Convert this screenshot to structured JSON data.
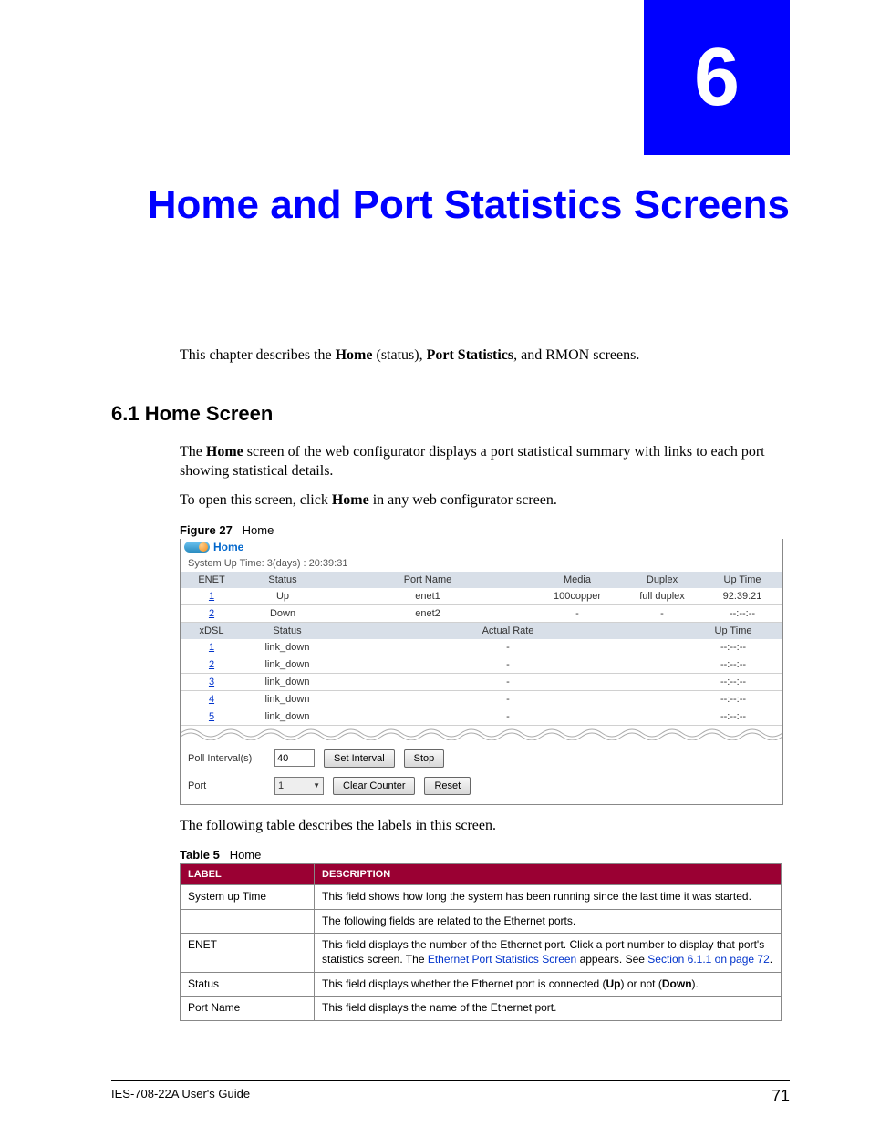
{
  "chapter": {
    "number": "6",
    "title": "Home and Port Statistics Screens"
  },
  "intro": {
    "pre": "This chapter describes the ",
    "b1": "Home",
    "mid1": " (status), ",
    "b2": "Port Statistics",
    "post": ", and RMON screens."
  },
  "section": {
    "heading": "6.1  Home Screen",
    "p1": {
      "pre": "The ",
      "b": "Home",
      "post": " screen of the web configurator displays a port statistical summary with links to each port showing statistical details."
    },
    "p2": {
      "pre": "To open this screen, click ",
      "b": "Home",
      "post": " in any web configurator screen."
    }
  },
  "figure": {
    "label": "Figure 27",
    "caption": "Home"
  },
  "screenshot": {
    "title": "Home",
    "uptime_label": "System Up Time: 3(days) : 20:39:31",
    "enet": {
      "headers": [
        "ENET",
        "Status",
        "Port Name",
        "Media",
        "Duplex",
        "Up Time"
      ],
      "rows": [
        {
          "port": "1",
          "status": "Up",
          "name": "enet1",
          "media": "100copper",
          "duplex": "full duplex",
          "uptime": "92:39:21"
        },
        {
          "port": "2",
          "status": "Down",
          "name": "enet2",
          "media": "-",
          "duplex": "-",
          "uptime": "--:--:--"
        }
      ]
    },
    "xdsl": {
      "headers": [
        "xDSL",
        "Status",
        "Actual Rate",
        "Up Time"
      ],
      "rows": [
        {
          "port": "1",
          "status": "link_down",
          "rate": "-",
          "uptime": "--:--:--"
        },
        {
          "port": "2",
          "status": "link_down",
          "rate": "-",
          "uptime": "--:--:--"
        },
        {
          "port": "3",
          "status": "link_down",
          "rate": "-",
          "uptime": "--:--:--"
        },
        {
          "port": "4",
          "status": "link_down",
          "rate": "-",
          "uptime": "--:--:--"
        },
        {
          "port": "5",
          "status": "link_down",
          "rate": "-",
          "uptime": "--:--:--"
        }
      ]
    },
    "controls": {
      "poll_label": "Poll Interval(s)",
      "poll_value": "40",
      "set_interval": "Set Interval",
      "stop": "Stop",
      "port_label": "Port",
      "port_value": "1",
      "clear_counter": "Clear Counter",
      "reset": "Reset"
    }
  },
  "after_fig": "The following table describes the labels in this screen.",
  "table": {
    "label": "Table 5",
    "caption": "Home",
    "headers": [
      "LABEL",
      "DESCRIPTION"
    ],
    "rows": [
      {
        "label": "System up Time",
        "desc": "This field shows how long the system has been running since the last time it was started."
      },
      {
        "label": "",
        "desc": "The following fields are related to the Ethernet ports."
      },
      {
        "label": "ENET",
        "desc_pre": "This field displays the number of the Ethernet port. Click a port number to display that port's statistics screen. The ",
        "link1": "Ethernet Port Statistics Screen",
        "desc_mid": " appears. See ",
        "link2": "Section 6.1.1 on page 72",
        "desc_post": "."
      },
      {
        "label": "Status",
        "desc_pre": "This field displays whether the Ethernet port is connected (",
        "b1": "Up",
        "desc_mid": ") or not (",
        "b2": "Down",
        "desc_post": ")."
      },
      {
        "label": "Port Name",
        "desc": "This field displays the name of the Ethernet port."
      }
    ]
  },
  "footer": {
    "guide": "IES-708-22A User's Guide",
    "page": "71"
  }
}
